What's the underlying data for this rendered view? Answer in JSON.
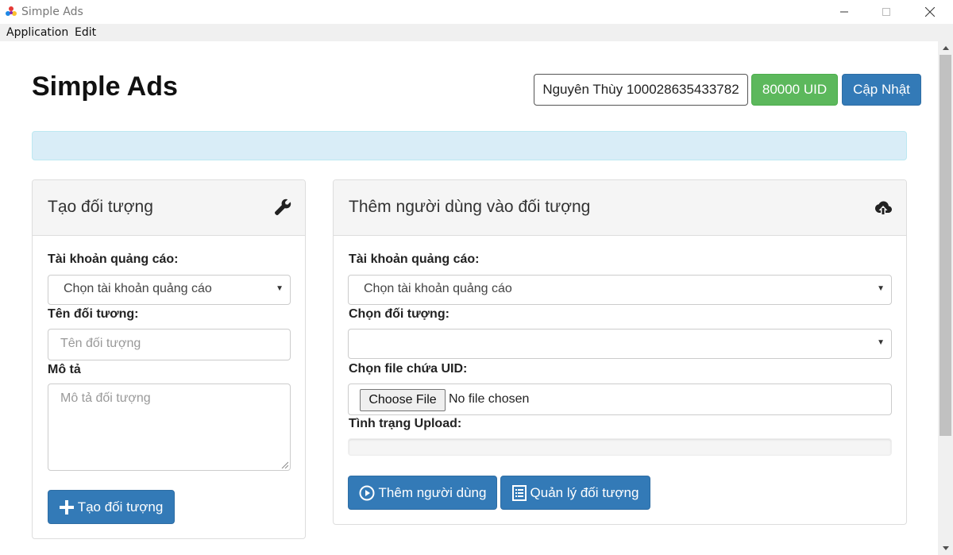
{
  "window": {
    "title": "Simple Ads"
  },
  "menu": {
    "items": [
      "Application",
      "Edit"
    ]
  },
  "header": {
    "title": "Simple Ads",
    "user_button": "Nguyên Thùy 100028635433782",
    "uid_badge": "80000 UID",
    "update_button": "Cập Nhật"
  },
  "create_panel": {
    "title": "Tạo đối tượng",
    "icon": "wrench-icon",
    "ad_account_label": "Tài khoản quảng cáo:",
    "ad_account_select": "Chọn tài khoản quảng cáo",
    "audience_name_label": "Tên đối tương:",
    "audience_name_placeholder": "Tên đối tượng",
    "description_label": "Mô tả",
    "description_placeholder": "Mô tả đối tượng",
    "create_button": "Tạo đối tượng"
  },
  "add_panel": {
    "title": "Thêm người dùng vào đối tượng",
    "icon": "cloud-upload-icon",
    "ad_account_label": "Tài khoản quảng cáo:",
    "ad_account_select": "Chọn tài khoản quảng cáo",
    "audience_label": "Chọn đối tượng:",
    "audience_select": "",
    "file_label": "Chọn file chứa UID:",
    "choose_file_button": "Choose File",
    "file_status": "No file chosen",
    "upload_status_label": "Tình trạng Upload:",
    "upload_progress": 0,
    "add_users_button": "Thêm người dùng",
    "manage_button": "Quản lý đối tượng"
  },
  "colors": {
    "primary": "#337ab7",
    "success": "#5cb85c",
    "info_bg": "#d9edf7",
    "panel_heading_bg": "#f5f5f5"
  }
}
